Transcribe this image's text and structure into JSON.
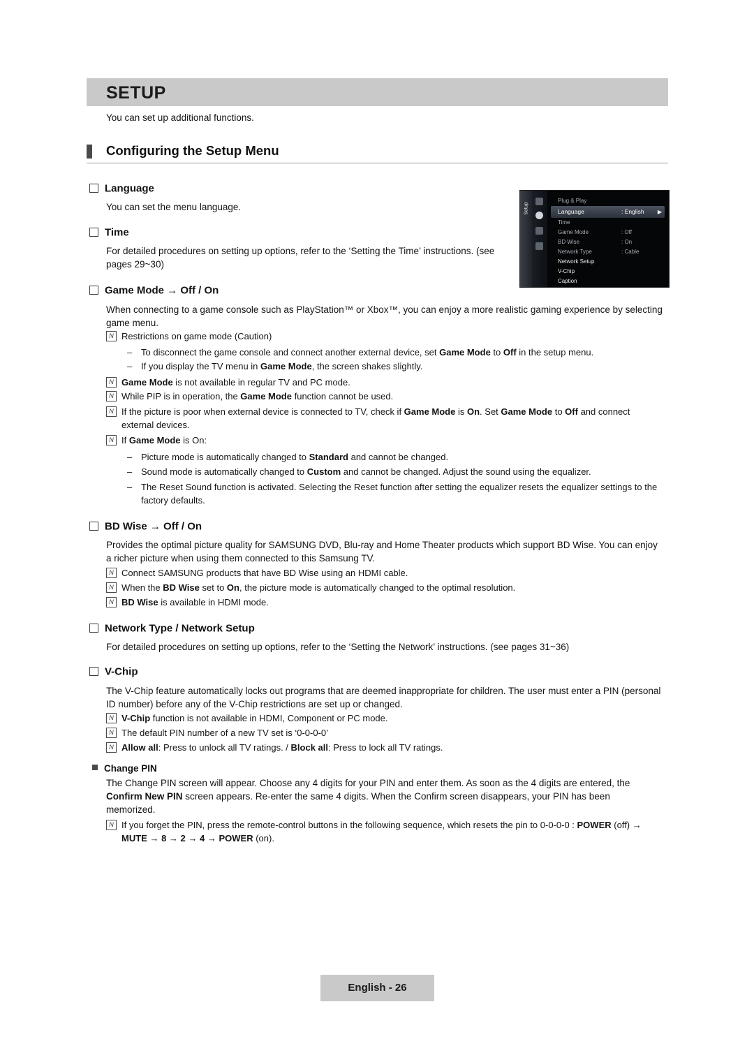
{
  "header": {
    "title": "SETUP",
    "intro": "You can set up additional functions."
  },
  "section": {
    "title": "Configuring the Setup Menu"
  },
  "language": {
    "heading": "Language",
    "body": "You can set the menu language."
  },
  "time": {
    "heading": "Time",
    "body": "For detailed procedures on setting up options, refer to the ‘Setting the Time’ instructions. (see pages 29~30)"
  },
  "game_mode": {
    "heading": "Game Mode → Off / On",
    "body": "When connecting to a game console such as PlayStation™ or Xbox™, you can enjoy a more realistic gaming experience by selecting game menu.",
    "notes": [
      "Restrictions on game mode (Caution)",
      "Game Mode is not available in regular TV and PC mode.",
      "While PIP is in operation, the Game Mode function cannot be used.",
      "If the picture is poor when external device is connected to TV, check if Game Mode is On. Set Game Mode to Off and connect external devices.",
      "If Game Mode is On:"
    ],
    "dashes_1": [
      "To disconnect the game console and connect another external device, set Game Mode to Off in the setup menu.",
      "If you display the TV menu in Game Mode, the screen shakes slightly."
    ],
    "dashes_2": [
      "Picture mode is automatically changed to Standard and cannot be changed.",
      "Sound mode is automatically changed to Custom and cannot be changed. Adjust the sound using the equalizer.",
      "The Reset Sound function is activated. Selecting the Reset function after setting the equalizer resets the equalizer settings to the factory defaults."
    ]
  },
  "bd_wise": {
    "heading": "BD Wise → Off / On",
    "body": "Provides the optimal picture quality for SAMSUNG DVD, Blu-ray and Home Theater products which support BD Wise. You can enjoy a richer picture when using them connected to this Samsung TV.",
    "notes": [
      "Connect SAMSUNG products that have BD Wise using an HDMI cable.",
      "When the BD Wise set to On, the picture mode is automatically changed to the optimal resolution.",
      "BD Wise is available in HDMI mode."
    ]
  },
  "network": {
    "heading": "Network Type / Network Setup",
    "body": "For detailed procedures on setting up options, refer to the ‘Setting the Network’ instructions. (see pages 31~36)"
  },
  "vchip": {
    "heading": "V-Chip",
    "body": "The V-Chip feature automatically locks out programs that are deemed inappropriate for children. The user must enter a PIN (personal ID number) before any of the V-Chip restrictions are set up or changed.",
    "notes": [
      "V-Chip function is not available in HDMI, Component or PC mode.",
      "The default PIN number of a new TV set is ‘0-0-0-0’",
      "Allow all: Press to unlock all TV ratings. / Block all: Press to lock all TV ratings."
    ],
    "change_pin": {
      "heading": "Change PIN",
      "body": "The Change PIN screen will appear. Choose any 4 digits for your PIN and enter them. As soon as the 4 digits are entered, the Confirm New PIN screen appears. Re-enter the same 4 digits. When the Confirm screen disappears, your PIN has been memorized.",
      "note": "If you forget the PIN, press the remote-control buttons in the following sequence, which resets the pin to 0-0-0-0 : POWER (off) → MUTE → 8 → 2 → 4 → POWER (on)."
    }
  },
  "osd": {
    "side_label": "Setup",
    "rows": [
      {
        "label": "Plug & Play",
        "value": ""
      },
      {
        "label": "Language",
        "value": ": English"
      },
      {
        "label": "Time",
        "value": ""
      },
      {
        "label": "Game Mode",
        "value": ": Off"
      },
      {
        "label": "BD Wise",
        "value": ": On"
      },
      {
        "label": "Network Type",
        "value": ": Cable"
      },
      {
        "label": "Network Setup",
        "value": ""
      },
      {
        "label": "V-Chip",
        "value": ""
      },
      {
        "label": "Caption",
        "value": ""
      }
    ],
    "arrow": "▶"
  },
  "footer": {
    "text": "English - 26"
  }
}
